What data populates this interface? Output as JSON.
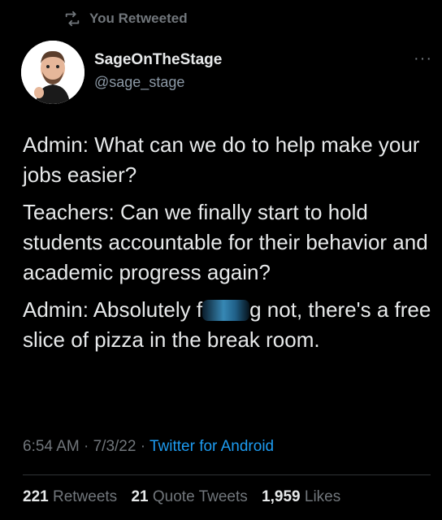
{
  "retweet_notice": {
    "text": "You Retweeted",
    "icon": "retweet-icon"
  },
  "author": {
    "display_name": "SageOnTheStage",
    "handle": "@sage_stage",
    "avatar": "avatar-image"
  },
  "more_icon": "more-icon",
  "tweet": {
    "lines": {
      "admin1": "Admin: What can we do to help make your jobs easier?",
      "teachers": "Teachers: Can we finally start to hold students accountable for their behavior and academic progress again?",
      "admin2_before": "Admin: Absolutely f",
      "admin2_after": "g not, there's a free slice of pizza in the break room."
    }
  },
  "meta": {
    "time": "6:54 AM",
    "date": "7/3/22",
    "source": "Twitter for Android"
  },
  "stats": [
    {
      "count": "221",
      "label": "Retweets"
    },
    {
      "count": "21",
      "label": "Quote Tweets"
    },
    {
      "count": "1,959",
      "label": "Likes"
    }
  ],
  "colors": {
    "background": "#000000",
    "text": "#e7e9ea",
    "secondary": "#71767b",
    "link": "#1d9bf0"
  }
}
